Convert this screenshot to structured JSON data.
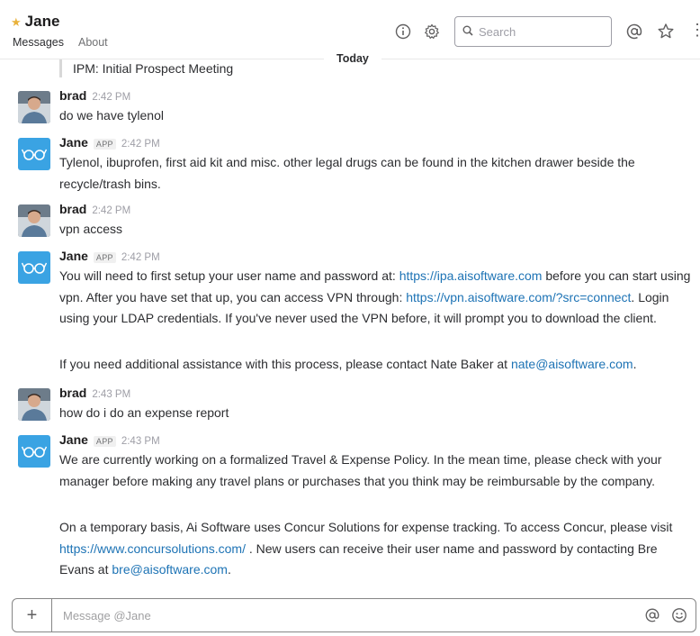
{
  "header": {
    "channel_name": "Jane",
    "tabs": [
      {
        "label": "Messages",
        "active": true
      },
      {
        "label": "About",
        "active": false
      }
    ],
    "search_placeholder": "Search",
    "more_label": "⋮"
  },
  "day_divider": "Today",
  "quoted_text": "IPM: Initial Prospect Meeting",
  "messages": [
    {
      "author": "brad",
      "time": "2:42 PM",
      "avatar": "brad-photo",
      "lines": [
        "do we have tylenol"
      ]
    },
    {
      "author": "Jane",
      "badge": "APP",
      "time": "2:42 PM",
      "avatar": "glasses-icon",
      "text": "Tylenol, ibuprofen, first aid kit and misc. other legal drugs can be found in the kitchen drawer beside the recycle/trash bins."
    },
    {
      "author": "brad",
      "time": "2:42 PM",
      "avatar": "brad-photo",
      "lines": [
        "vpn access"
      ]
    },
    {
      "author": "Jane",
      "badge": "APP",
      "time": "2:42 PM",
      "avatar": "glasses-icon",
      "p1_a": "You will need to first setup your user name and password at: ",
      "p1_link1": "https://ipa.aisoftware.com",
      "p1_b": " before you can start using vpn. After you have set that up, you can access VPN through: ",
      "p1_link2": "https://vpn.aisoftware.com/?src=connect",
      "p1_c": ". Login using your LDAP credentials. If you've never used the VPN before, it will prompt you to download the client.",
      "p2_a": "If you need additional assistance with this process, please contact Nate Baker at ",
      "p2_link": "nate@aisoftware.com",
      "p2_b": "."
    },
    {
      "author": "brad",
      "time": "2:43 PM",
      "avatar": "brad-photo",
      "lines": [
        "how do i do an expense report"
      ]
    },
    {
      "author": "Jane",
      "badge": "APP",
      "time": "2:43 PM",
      "avatar": "glasses-icon",
      "p1": "We are currently working on a formalized Travel & Expense Policy. In the mean time, please check with your manager before making any travel plans or purchases that you think may be reimbursable by the company.",
      "p2_a": "On a temporary basis, Ai Software uses Concur Solutions for expense tracking. To access Concur, please visit ",
      "p2_link1": "https://www.concursolutions.com/",
      "p2_b": " . New users can receive their user name and password by contacting Bre Evans at ",
      "p2_link2": "bre@aisoftware.com",
      "p2_c": "."
    }
  ],
  "composer": {
    "plus_label": "+",
    "placeholder": "Message @Jane"
  },
  "colors": {
    "link": "#1d73b5",
    "star": "#e9b23c",
    "app_avatar": "#3aa3e3"
  }
}
